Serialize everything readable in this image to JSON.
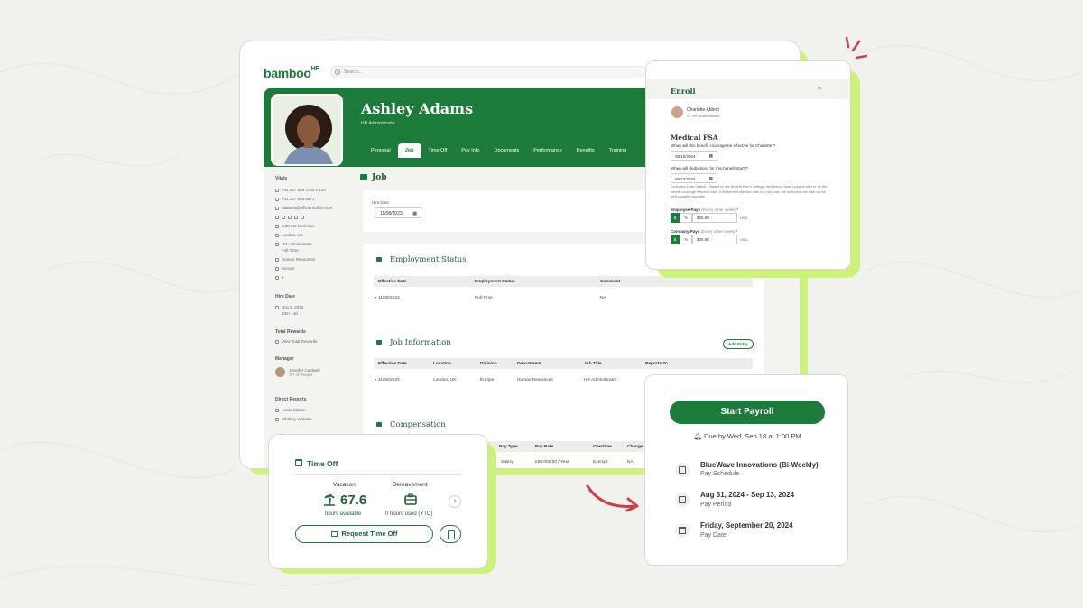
{
  "app": {
    "logo_main": "bamboo",
    "logo_suffix": "HR",
    "search_placeholder": "Search..."
  },
  "employee": {
    "name": "Ashley Adams",
    "title": "HR Administrator"
  },
  "tabs": [
    "Personal",
    "Job",
    "Time Off",
    "Pay Info",
    "Documents",
    "Performance",
    "Benefits",
    "Training"
  ],
  "active_tab": "Job",
  "left_panel": {
    "vitals_label": "Vitals",
    "vitals": [
      "+44 207 555 4730 x 100",
      "+44 207 555 6871",
      "aadams@efficientoffice.com",
      "8:20 AM local time",
      "London, UK",
      "HR Administrator",
      "Full-Time",
      "Human Resources",
      "Europe",
      "2"
    ],
    "hire_date_label": "Hire Date",
    "hire_date": "Nov 8, 2022",
    "hire_tenure": "10m - 4d",
    "total_rewards_label": "Total Rewards",
    "total_rewards_link": "View Total Rewards",
    "manager_label": "Manager",
    "manager_name": "Jennifer Caldwell",
    "manager_role": "VP of People",
    "direct_reports_label": "Direct Reports",
    "direct_reports": [
      "Lewis Station",
      "Whitney Webster"
    ]
  },
  "job": {
    "heading": "Job",
    "hire_date_label": "Hire Date",
    "hire_date_value": "11/08/2023",
    "employment_status": {
      "title": "Employment Status",
      "columns": [
        "Effective Date",
        "Employment Status",
        "Comment"
      ],
      "rows": [
        [
          "11/08/2022",
          "Full-Time",
          "NA"
        ]
      ]
    },
    "job_information": {
      "title": "Job Information",
      "add_entry": "Add Entry",
      "columns": [
        "Effective Date",
        "Location",
        "Division",
        "Department",
        "Job Title",
        "Reports To"
      ],
      "rows": [
        [
          "11/08/2023",
          "London, UK",
          "Europe",
          "Human Resources",
          "HR Administrator",
          ""
        ]
      ]
    },
    "compensation": {
      "title": "Compensation",
      "columns": [
        "Pay Type",
        "Pay Rate",
        "Overtime",
        "Change"
      ],
      "rows": [
        [
          "Salary",
          "£50,000.00 / Year",
          "Exempt",
          "NA"
        ]
      ]
    }
  },
  "enroll": {
    "title": "Enroll",
    "close": "×",
    "person_name": "Charlotte Abbott",
    "person_role": "Sr. HR Administrator",
    "plan": "Medical FSA",
    "q1": "When will this benefit coverage be effective for Charlotte?*",
    "q1_value": "09/10/2024",
    "q2": "When will deductions for this benefit start?*",
    "q2_value": "09/13/2024",
    "note": "Deduction Date Default – Based on the Benefit Plan's settings, deductions start 1 payroll after or on the benefit coverage effective date. If the benefit effective date is in the past, the deduction will start on the next possible pay date.",
    "employee_pays_label": "Employee Pays",
    "employee_pays_hint": "(Every other week)",
    "employee_pays_value": "$25.00",
    "company_pays_label": "Company Pays",
    "company_pays_hint": "(Every other week)",
    "company_pays_value": "$25.00",
    "currency_symbol": "$",
    "percent_symbol": "%",
    "unit": "USD"
  },
  "time_off": {
    "title": "Time Off",
    "vacation_label": "Vacation",
    "vacation_value": "67.6",
    "vacation_sub": "hours available",
    "bereavement_label": "Bereavement",
    "bereavement_sub": "0 hours used (YTD)",
    "next": "›",
    "request_button": "Request Time Off"
  },
  "payroll": {
    "start_button": "Start Payroll",
    "due": "Due by Wed, Sep 18 at 1:00 PM",
    "items": [
      {
        "title": "BlueWave Innovations (Bi-Weekly)",
        "sub": "Pay Schedule",
        "icon": "calendar-icon"
      },
      {
        "title": "Aug 31, 2024 - Sep 13, 2024",
        "sub": "Pay Period",
        "icon": "calendar-range-icon"
      },
      {
        "title": "Friday, September 20, 2024",
        "sub": "Pay Date",
        "icon": "bank-icon"
      }
    ]
  },
  "colors": {
    "brand_green": "#1c7a3a",
    "lime_accent": "#cdf27a",
    "arrow_red": "#c8414a"
  }
}
